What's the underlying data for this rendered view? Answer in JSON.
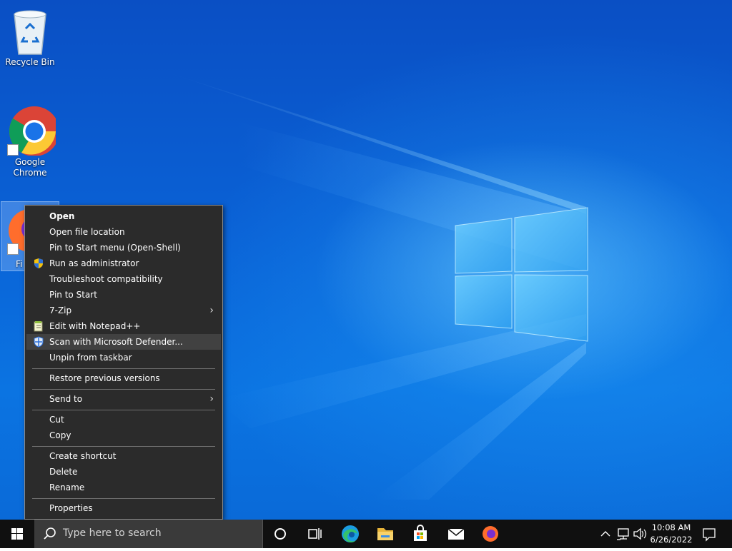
{
  "desktop": {
    "icons": [
      {
        "label": "Recycle Bin",
        "icon": "recycle-bin-icon"
      },
      {
        "label": "Google Chrome",
        "label_lines": [
          "Google",
          "Chrome"
        ],
        "icon": "chrome-icon"
      },
      {
        "label": "Fi",
        "icon": "firefox-icon",
        "selected": true
      }
    ]
  },
  "context_menu": {
    "items": [
      {
        "label": "Open",
        "bold": true
      },
      {
        "label": "Open file location"
      },
      {
        "label": "Pin to Start menu (Open-Shell)"
      },
      {
        "label": "Run as administrator",
        "icon": "uac-shield-icon"
      },
      {
        "label": "Troubleshoot compatibility"
      },
      {
        "label": "Pin to Start"
      },
      {
        "label": "7-Zip",
        "submenu": true
      },
      {
        "label": "Edit with Notepad++",
        "icon": "notepad-plus-plus-icon"
      },
      {
        "label": "Scan with Microsoft Defender...",
        "icon": "defender-shield-icon",
        "highlighted": true
      },
      {
        "label": "Unpin from taskbar"
      },
      {
        "label": "Restore previous versions"
      },
      {
        "label": "Send to",
        "submenu": true
      },
      {
        "label": "Cut"
      },
      {
        "label": "Copy"
      },
      {
        "label": "Create shortcut"
      },
      {
        "label": "Delete"
      },
      {
        "label": "Rename"
      },
      {
        "label": "Properties"
      }
    ],
    "submenu_arrow": "›"
  },
  "taskbar": {
    "search_placeholder": "Type here to search",
    "pinned": [
      "start-icon",
      "cortana-icon",
      "task-view-icon",
      "edge-icon",
      "file-explorer-icon",
      "store-icon",
      "mail-icon",
      "firefox-icon"
    ],
    "tray": [
      "chevron-up-icon",
      "network-icon",
      "volume-icon"
    ],
    "time": "10:08 AM",
    "date": "6/26/2022"
  },
  "colors": {
    "menu_bg": "#2b2b2b",
    "menu_hover": "#414141",
    "taskbar_bg": "#101010",
    "accent": "#0a62d6"
  }
}
